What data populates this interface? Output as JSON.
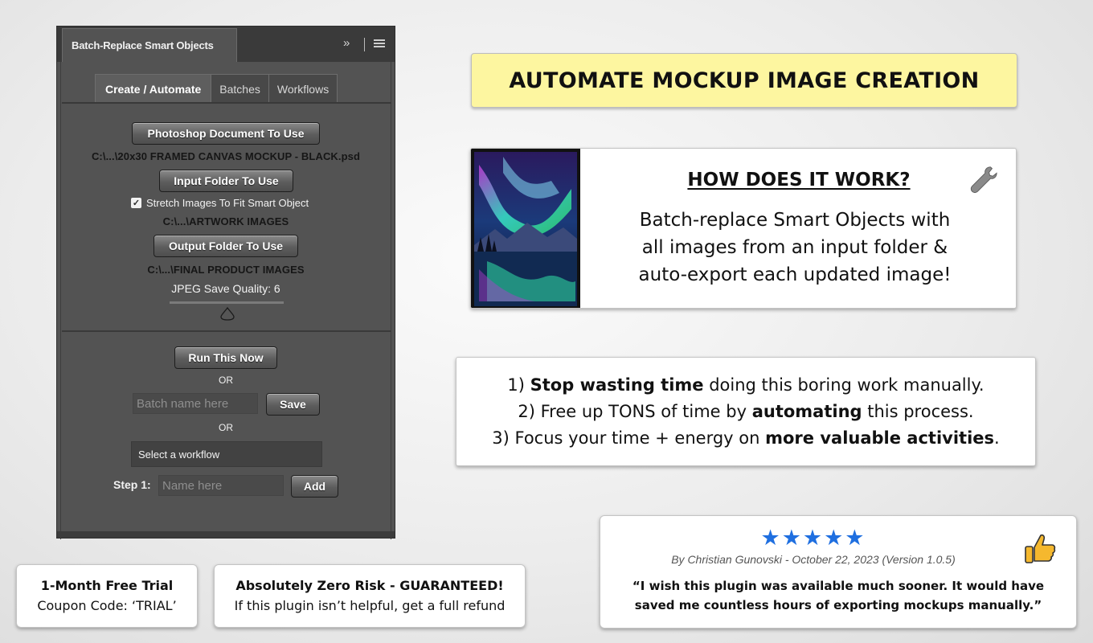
{
  "panel": {
    "title": "Batch-Replace Smart Objects",
    "expand_glyph": "»",
    "tabs": [
      {
        "label": "Create / Automate",
        "active": true
      },
      {
        "label": "Batches",
        "active": false
      },
      {
        "label": "Workflows",
        "active": false
      }
    ],
    "psd_button": "Photoshop Document To Use",
    "psd_path": "C:\\...\\20x30 FRAMED CANVAS MOCKUP - BLACK.psd",
    "input_button": "Input Folder To Use",
    "stretch_checkbox": {
      "label": "Stretch Images To Fit Smart Object",
      "checked": true
    },
    "input_path": "C:\\...\\ARTWORK IMAGES",
    "output_button": "Output Folder To Use",
    "output_path": "C:\\...\\FINAL PRODUCT IMAGES",
    "jpeg_quality_label": "JPEG Save Quality: 6",
    "jpeg_quality_value": 6,
    "run_button": "Run This Now",
    "or_text": "OR",
    "batch_name_placeholder": "Batch name here",
    "save_button": "Save",
    "workflow_select": "Select a workflow",
    "step_label": "Step 1:",
    "step_placeholder": "Name here",
    "add_button": "Add"
  },
  "headline": "AUTOMATE MOCKUP IMAGE CREATION",
  "how_it_works": {
    "title": "HOW DOES IT WORK?",
    "lines": [
      "Batch-replace Smart Objects with",
      "all images from an input folder &",
      "auto-export each updated image!"
    ]
  },
  "points": [
    {
      "prefix": "1) ",
      "bold": "Stop wasting time",
      "rest": " doing this boring work manually."
    },
    {
      "prefix": "2) Free up TONS of time by ",
      "bold": "automating",
      "rest": " this process."
    },
    {
      "prefix": "3) Focus your time + energy on ",
      "bold": "more valuable activities",
      "rest": "."
    }
  ],
  "review": {
    "stars": "★★★★★",
    "rating": 5,
    "byline": "By Christian Gunovski - October 22, 2023 (Version 1.0.5)",
    "quote_line1": "“I wish this plugin was available much sooner. It would have",
    "quote_line2": "saved me countless hours of exporting mockups manually.”"
  },
  "trial_card": {
    "line1": "1-Month Free Trial",
    "line2": "Coupon Code: ‘TRIAL’"
  },
  "guarantee_card": {
    "line1": "Absolutely Zero Risk - GUARANTEED!",
    "line2": "If this plugin isn’t helpful, get a full refund"
  },
  "colors": {
    "panel_bg": "#535353",
    "headline_bg": "#fdf6a0",
    "star_blue": "#1f6fe0",
    "thumb_yellow": "#f5b82e"
  }
}
